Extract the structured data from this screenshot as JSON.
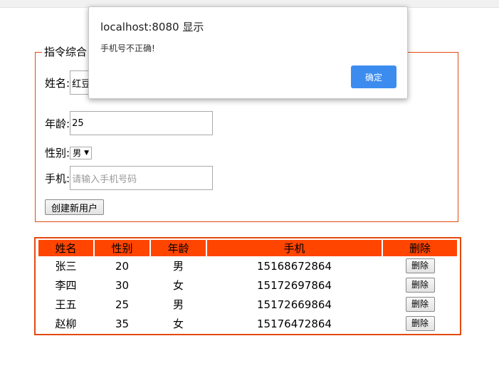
{
  "form": {
    "legend": "指令综合",
    "name_label": "姓名:",
    "name_value": "红豆",
    "age_label": "年龄:",
    "age_value": "25",
    "gender_label": "性别:",
    "gender_value": "男",
    "phone_label": "手机:",
    "phone_placeholder": "请输入手机号码",
    "create_button": "创建新用户"
  },
  "table": {
    "headers": [
      "姓名",
      "性别",
      "年龄",
      "手机",
      "删除"
    ],
    "rows": [
      {
        "c1": "张三",
        "c2": "20",
        "c3": "男",
        "phone": "15168672864",
        "action": "删除"
      },
      {
        "c1": "李四",
        "c2": "30",
        "c3": "女",
        "phone": "15172697864",
        "action": "删除"
      },
      {
        "c1": "王五",
        "c2": "25",
        "c3": "男",
        "phone": "15172669864",
        "action": "删除"
      },
      {
        "c1": "赵柳",
        "c2": "35",
        "c3": "女",
        "phone": "15176472864",
        "action": "删除"
      }
    ]
  },
  "dialog": {
    "title": "localhost:8080 显示",
    "message": "手机号不正确!",
    "ok_label": "确定"
  },
  "colors": {
    "accent_border": "#e34a10",
    "header_bg": "#ff4500",
    "dialog_button": "#3c8cf0"
  }
}
